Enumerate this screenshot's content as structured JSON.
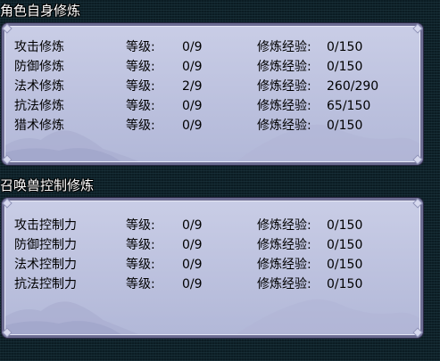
{
  "char_section": {
    "title": "角色自身修炼",
    "rows": [
      {
        "name": "攻击修炼",
        "level_label": "等级:",
        "level": "0/9",
        "exp_label": "修炼经验:",
        "exp": "0/150"
      },
      {
        "name": "防御修炼",
        "level_label": "等级:",
        "level": "0/9",
        "exp_label": "修炼经验:",
        "exp": "0/150"
      },
      {
        "name": "法术修炼",
        "level_label": "等级:",
        "level": "2/9",
        "exp_label": "修炼经验:",
        "exp": "260/290"
      },
      {
        "name": "抗法修炼",
        "level_label": "等级:",
        "level": "0/9",
        "exp_label": "修炼经验:",
        "exp": "65/150"
      },
      {
        "name": "猎术修炼",
        "level_label": "等级:",
        "level": "0/9",
        "exp_label": "修炼经验:",
        "exp": "0/150"
      }
    ]
  },
  "pet_section": {
    "title": "召唤兽控制修炼",
    "rows": [
      {
        "name": "攻击控制力",
        "level_label": "等级:",
        "level": "0/9",
        "exp_label": "修炼经验:",
        "exp": "0/150"
      },
      {
        "name": "防御控制力",
        "level_label": "等级:",
        "level": "0/9",
        "exp_label": "修炼经验:",
        "exp": "0/150"
      },
      {
        "name": "法术控制力",
        "level_label": "等级:",
        "level": "0/9",
        "exp_label": "修炼经验:",
        "exp": "0/150"
      },
      {
        "name": "抗法控制力",
        "level_label": "等级:",
        "level": "0/9",
        "exp_label": "修炼经验:",
        "exp": "0/150"
      }
    ]
  }
}
